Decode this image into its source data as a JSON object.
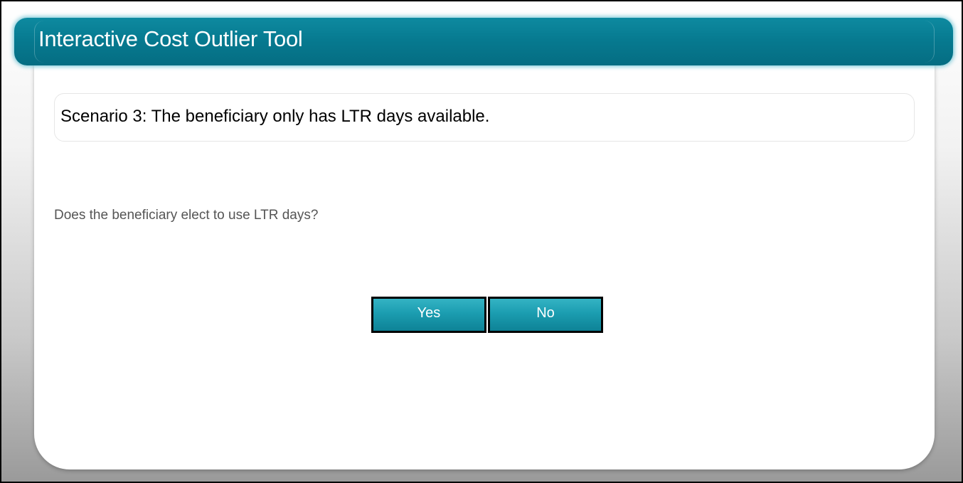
{
  "app": {
    "title": "Interactive Cost Outlier Tool"
  },
  "scenario": {
    "text": "Scenario 3: The beneficiary only has LTR days available."
  },
  "question": {
    "text": "Does the beneficiary elect to use LTR days?"
  },
  "buttons": {
    "yes_label": "Yes",
    "no_label": "No"
  },
  "colors": {
    "title_bar": "#06798f",
    "button": "#1b9db0",
    "button_text": "#ffffff",
    "question_text": "#555555"
  }
}
